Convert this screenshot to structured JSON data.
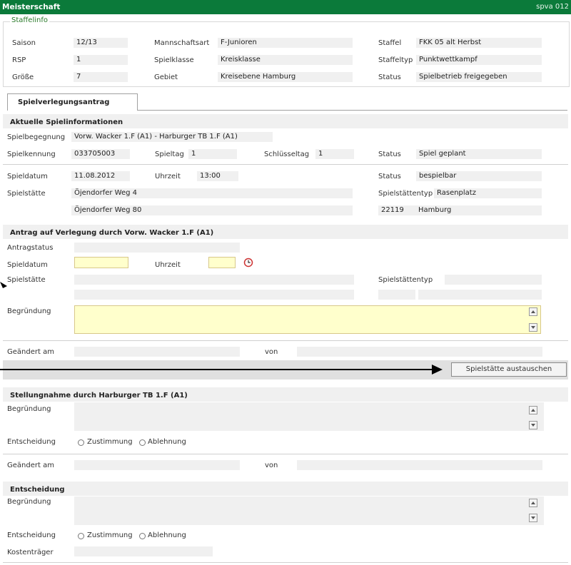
{
  "window": {
    "title": "Meisterschaft",
    "code": "spva 012"
  },
  "staffelinfo": {
    "legend": "Staffelinfo",
    "saison_label": "Saison",
    "saison": "12/13",
    "rsp_label": "RSP",
    "rsp": "1",
    "groesse_label": "Größe",
    "groesse": "7",
    "mannschaftsart_label": "Mannschaftsart",
    "mannschaftsart": "F-Junioren",
    "spielklasse_label": "Spielklasse",
    "spielklasse": "Kreisklasse",
    "gebiet_label": "Gebiet",
    "gebiet": "Kreisebene Hamburg",
    "staffel_label": "Staffel",
    "staffel": "FKK 05 alt Herbst",
    "staffeltyp_label": "Staffeltyp",
    "staffeltyp": "Punktwettkampf",
    "status_label": "Status",
    "status": "Spielbetrieb freigegeben"
  },
  "tab": {
    "label": "Spielverlegungsantrag"
  },
  "aktuelle": {
    "header": "Aktuelle Spielinformationen",
    "spielbegegnung_label": "Spielbegegnung",
    "spielbegegnung": "Vorw. Wacker 1.F (A1) - Harburger TB 1.F (A1)",
    "spielkennung_label": "Spielkennung",
    "spielkennung": "033705003",
    "spieltag_label": "Spieltag",
    "spieltag": "1",
    "schluesseltag_label": "Schlüsseltag",
    "schluesseltag": "1",
    "status_label": "Status",
    "status": "Spiel geplant",
    "spieldatum_label": "Spieldatum",
    "spieldatum": "11.08.2012",
    "uhrzeit_label": "Uhrzeit",
    "uhrzeit": "13:00",
    "status2_label": "Status",
    "status2": "bespielbar",
    "spielstaette_label": "Spielstätte",
    "spielstaette1": "Öjendorfer Weg 4",
    "spielstaette2": "Öjendorfer Weg 80",
    "spielstaettentyp_label": "Spielstättentyp",
    "spielstaettentyp": "Rasenplatz",
    "plz": "22119",
    "ort": "Hamburg"
  },
  "antrag": {
    "header": "Antrag auf Verlegung durch Vorw. Wacker 1.F (A1)",
    "antragstatus_label": "Antragstatus",
    "spieldatum_label": "Spieldatum",
    "uhrzeit_label": "Uhrzeit",
    "spielstaette_label": "Spielstätte",
    "spielstaettentyp_label": "Spielstättentyp",
    "begruendung_label": "Begründung",
    "geaendert_label": "Geändert am",
    "von_label": "von",
    "button": "Spielstätte austauschen"
  },
  "stellungnahme": {
    "header": "Stellungnahme durch Harburger TB 1.F (A1)",
    "begruendung_label": "Begründung",
    "entscheidung_label": "Entscheidung",
    "zustimmung": "Zustimmung",
    "ablehnung": "Ablehnung",
    "geaendert_label": "Geändert am",
    "von_label": "von"
  },
  "entscheidung": {
    "header": "Entscheidung",
    "begruendung_label": "Begründung",
    "entscheidung_label": "Entscheidung",
    "zustimmung": "Zustimmung",
    "ablehnung": "Ablehnung",
    "kostentraeger_label": "Kostenträger"
  },
  "colors": {
    "titlebar": "#0b7a3a",
    "input_yellow": "#ffffcc",
    "legend_green": "#2a7a2a"
  },
  "icons": [
    "clock-icon",
    "scroll-up-icon",
    "scroll-down-icon",
    "arrow-annotation"
  ]
}
